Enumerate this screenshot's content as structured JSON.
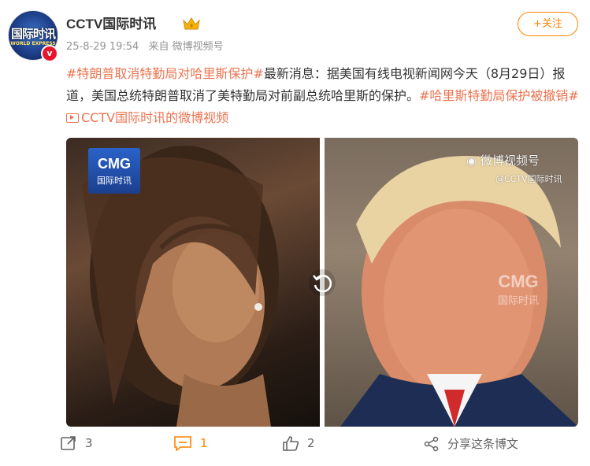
{
  "post": {
    "username": "CCTV国际时讯",
    "avatar_text": "国际时讯",
    "avatar_subtext": "WORLD EXPRESS",
    "verified_badge": "v",
    "time": "25-8-29 19:54",
    "source": "来自 微博视频号",
    "follow_label": "+关注",
    "content": {
      "tag1": "#特朗普取消特勤局对哈里斯保护#",
      "text1": "最新消息：据美国有线电视新闻网今天（8月29日）报道，美国总统特朗普取消了美特勤局对前副总统哈里斯的保护。",
      "tag2": "#哈里斯特勤局保护被撤销#",
      "video_link": "CCTV国际时讯的微博视频"
    },
    "media": {
      "left_badge_main": "CMG",
      "left_badge_sub": "国际时讯",
      "right_watermark_main": "微博视频号",
      "right_watermark_sub": "@CCTV国际时讯",
      "right_cmg_main": "CMG",
      "right_cmg_sub": "国际时讯",
      "left_image_icon": "photo-woman-icon",
      "right_image_icon": "photo-man-icon",
      "center_icon": "replay-icon"
    }
  },
  "actions": {
    "share_count": "3",
    "comment_count": "1",
    "like_count": "2",
    "share_to_label": "分享这条博文"
  },
  "colors": {
    "accent": "#ff8200",
    "tag": "#eb7350",
    "text": "#333333",
    "meta": "#939393"
  }
}
